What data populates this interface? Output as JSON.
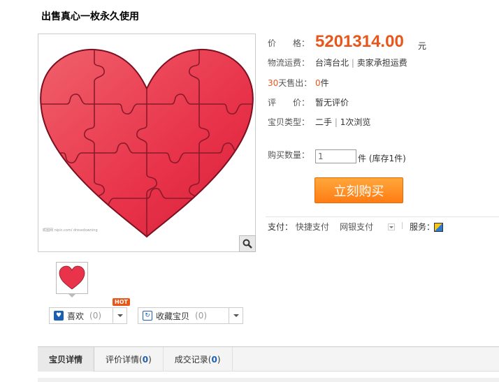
{
  "item": {
    "title": "出售真心一枚永久使用",
    "price_label": "价　　格：",
    "price": "5201314.00",
    "price_unit": "元",
    "shipping_label": "物流运费：",
    "shipping_location": "台湾台北",
    "shipping_sep": "|",
    "shipping_text": "卖家承担运费",
    "sold_days": "30",
    "sold_label": "天售出：",
    "sold_count": "0",
    "sold_unit": "件",
    "rating_label": "评　　价：",
    "rating_value": "暂无评价",
    "type_label": "宝贝类型：",
    "type_value": "二手",
    "type_sep": "|",
    "views": "1次浏览",
    "qty_label": "购买数量：",
    "qty_value": "1",
    "stock_text": "件 (库存1件)",
    "buy_button": "立刻购买",
    "pay_label": "支付：",
    "pay_option_1": "快捷支付",
    "pay_option_2": "网银支付",
    "service_label": "服务："
  },
  "gallery": {
    "watermark": "昵图网 nipic.com/ dressdowning"
  },
  "social": {
    "hot_badge": "HOT",
    "like_label": "喜欢",
    "like_count": "(0)",
    "fav_label": "收藏宝贝",
    "fav_count": "(0)"
  },
  "tabs": [
    {
      "label": "宝贝详情"
    },
    {
      "label": "评价详情",
      "count": "0"
    },
    {
      "label": "成交记录",
      "count": "0"
    }
  ],
  "colors": {
    "accent": "#e8561a",
    "heart": "#e8334a",
    "link": "#1a5fb4"
  }
}
